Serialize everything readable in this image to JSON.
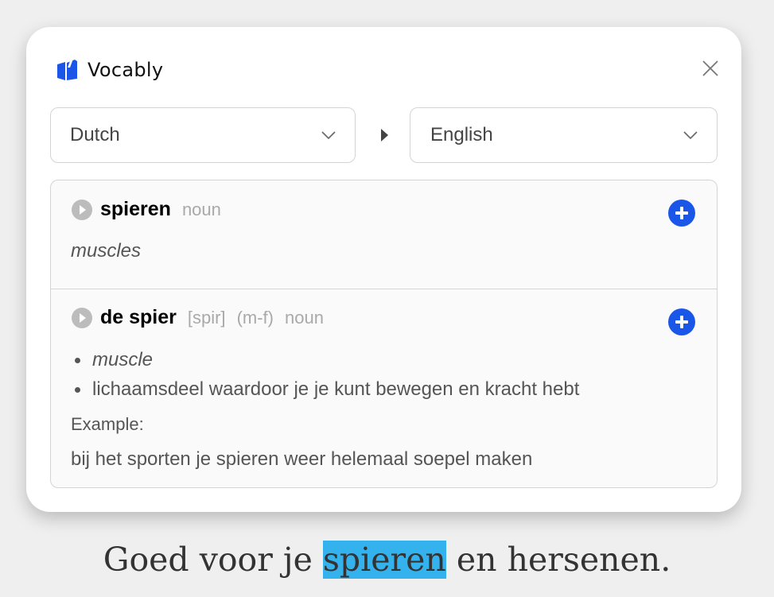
{
  "app": {
    "name": "Vocably"
  },
  "icons": {
    "logo": "vocably-logo-icon",
    "close": "close-icon",
    "chevron": "chevron-down-icon",
    "play": "play-icon",
    "add": "add-icon"
  },
  "colors": {
    "accent": "#1a56e8",
    "highlight": "#34b2ee"
  },
  "languages": {
    "source": "Dutch",
    "target": "English"
  },
  "entries": [
    {
      "word": "spieren",
      "pos": "noun",
      "translation": "muscles"
    },
    {
      "word": "de spier",
      "ipa": "[spir]",
      "gender": "(m-f)",
      "pos": "noun",
      "definitions": [
        "muscle",
        "lichaamsdeel waardoor je je kunt bewegen en kracht hebt"
      ],
      "example_label": "Example:",
      "example": "bij het sporten je spieren weer helemaal soepel maken"
    }
  ],
  "page_text": {
    "before": "Goed voor je ",
    "highlighted": "spieren",
    "after": " en hersenen."
  }
}
